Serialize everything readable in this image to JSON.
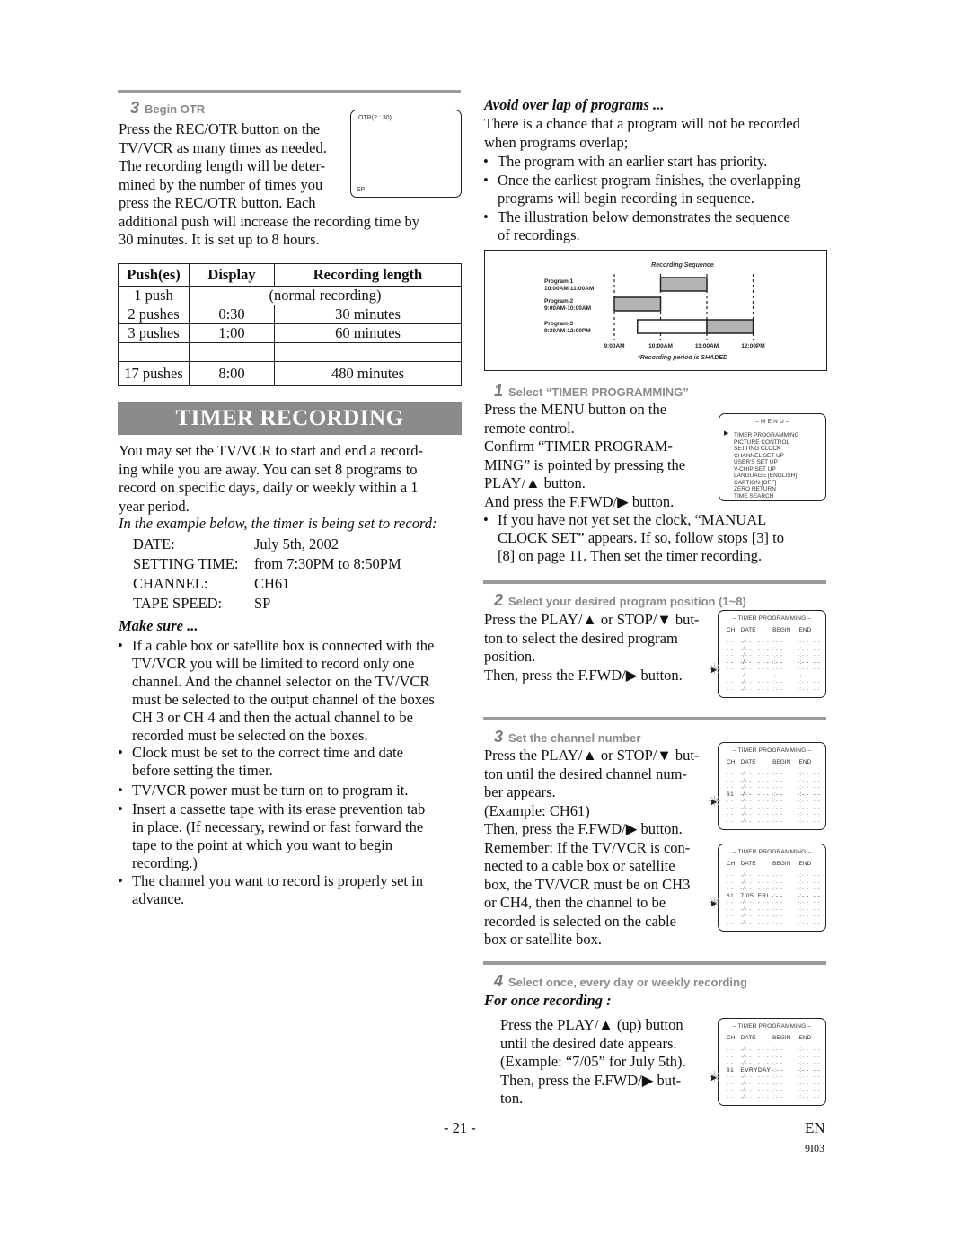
{
  "left": {
    "otr": {
      "step_num": "3",
      "step_title": "Begin OTR",
      "paragraph_lines": [
        "Press the REC/OTR button on the",
        "TV/VCR as many times as needed.",
        "The recording length will be deter-",
        "mined by the number of times you",
        "press the REC/OTR button. Each",
        "additional push will increase the recording time by",
        "30 minutes. It is set up to 8 hours."
      ],
      "screen": {
        "top_text": "OTR(2 : 30)",
        "bottom_text": "SP"
      }
    },
    "otr_table": {
      "headers": [
        "Push(es)",
        "Display",
        "Recording length"
      ],
      "rows": [
        {
          "pushes": "1 push",
          "merged": "(normal recording)"
        },
        {
          "pushes": "2 pushes",
          "display": "0:30",
          "length": "30 minutes"
        },
        {
          "pushes": "3 pushes",
          "display": "1:00",
          "length": "60 minutes"
        },
        {
          "pushes": "",
          "display": "",
          "length": ""
        },
        {
          "pushes": "17 pushes",
          "display": "8:00",
          "length": "480 minutes"
        }
      ]
    },
    "banner_title": "TIMER RECORDING",
    "intro_lines": [
      "You may set the TV/VCR to start and end a record-",
      "ing while you are away. You can set 8 programs to",
      "record on specific days, daily or weekly within a 1",
      "year period."
    ],
    "example_heading": "In the example below, the timer is being set to record:",
    "example": [
      {
        "label": "DATE:",
        "value": "July 5th, 2002"
      },
      {
        "label": "SETTING TIME:",
        "value": "from 7:30PM to 8:50PM"
      },
      {
        "label": "CHANNEL:",
        "value": "CH61"
      },
      {
        "label": "TAPE SPEED:",
        "value": "SP"
      }
    ],
    "make_sure_heading": "Make sure ...",
    "make_sure_bullets": [
      [
        "If a cable box or satellite box is connected with the",
        "TV/VCR you will be limited to record only one",
        "channel. And the channel selector on the TV/VCR",
        "must be selected to the output channel of the boxes",
        "CH 3 or CH 4 and then the actual channel to be",
        "recorded must be selected on the boxes."
      ],
      [
        "Clock must be set to the correct time and date",
        "before setting the timer."
      ],
      [
        "TV/VCR power must be turn on to program it."
      ],
      [
        "Insert a cassette tape with its erase prevention tab",
        "in place. (If necessary, rewind or fast forward the",
        "tape to the point at which you want to begin",
        "recording.)"
      ],
      [
        "The channel you want to record is properly set in",
        "advance."
      ]
    ]
  },
  "right": {
    "avoid_heading": "Avoid over lap of programs ...",
    "avoid_lines": [
      "There is a chance that a program will not be recorded",
      "when programs overlap;"
    ],
    "avoid_bullets": [
      [
        "The program with an earlier start has priority."
      ],
      [
        "Once the earliest program finishes, the overlapping",
        "programs will begin recording in sequence."
      ],
      [
        "The illustration below demonstrates the sequence",
        "of recordings."
      ]
    ],
    "sequence_diagram": {
      "title": "Recording Sequence",
      "footnote": "*Recording period is SHADED",
      "time_ticks": [
        "9:00AM",
        "10:00AM",
        "11:00AM",
        "12:00PM"
      ],
      "programs": [
        {
          "name": "Program 1",
          "time": "10:00AM-11:00AM",
          "start": 10,
          "end": 11,
          "recorded_start": 10,
          "recorded_end": 11
        },
        {
          "name": "Program 2",
          "time": "9:00AM-10:00AM",
          "start": 9,
          "end": 10,
          "recorded_start": 9,
          "recorded_end": 10
        },
        {
          "name": "Program 3",
          "time": "9:30AM-12:00PM",
          "start": 9.5,
          "end": 12,
          "recorded_start": 11,
          "recorded_end": 12
        }
      ],
      "colors": {
        "shaded": "#b4b4b4",
        "unshaded": "#ffffff"
      }
    },
    "step1": {
      "num": "1",
      "title": "Select “TIMER PROGRAMMING”",
      "lines": [
        "Press the MENU button on the",
        "remote control.",
        "Confirm “TIMER PROGRAM-",
        "MING” is pointed by pressing the",
        "PLAY/▲ button.",
        "And press the F.FWD/▶ button."
      ],
      "bullet": [
        "If you have not yet set the clock, “MANUAL",
        "CLOCK SET” appears. If so, follow stops [3] to",
        "[8] on page 11. Then set the timer recording."
      ],
      "menu": {
        "title": "– M E N U –",
        "items": [
          "TIMER PROGRAMMING",
          "PICTURE CONTROL",
          "SETTING CLOCK",
          "CHANNEL SET UP",
          "USER'S SET UP",
          "V-CHIP SET UP",
          "LANGUAGE  [ENGLISH]",
          "CAPTION  [OFF]",
          "ZERO RETURN",
          "TIME SEARCH"
        ],
        "selected_index": 0
      }
    },
    "step2": {
      "num": "2",
      "title": "Select your desired program position (1~8)",
      "lines": [
        "Press the PLAY/▲ or STOP/▼ but-",
        "ton to select the desired program",
        "position.",
        "Then, press the F.FWD/▶ button."
      ]
    },
    "step3": {
      "num": "3",
      "title": "Set the channel number",
      "lines": [
        "Press the PLAY/▲ or STOP/▼ but-",
        "ton until the desired channel num-",
        "ber appears.",
        "(Example: CH61)",
        "Then, press the F.FWD/▶ button.",
        "Remember: If the TV/VCR is con-",
        "nected to a cable box or satellite",
        "box, the TV/VCR must be on CH3",
        "or CH4, then the channel to be",
        "recorded is selected on the cable",
        "box or satellite box."
      ]
    },
    "step4": {
      "num": "4",
      "title": "Select once, every day or weekly recording",
      "subheading": "For once recording :",
      "lines": [
        "Press the PLAY/▲ (up) button",
        "until the desired date appears.",
        "(Example: “7/05” for July 5th).",
        "Then, press the F.FWD/▶ but-",
        "ton."
      ]
    },
    "timer_screen": {
      "title": "– TIMER PROGRAMMING –",
      "headers": [
        "CH",
        "DATE",
        "BEGIN",
        "END"
      ],
      "empty_cells": [
        "- -",
        "-/- -",
        "- - -",
        "-:- -",
        "-:- -",
        "- -"
      ]
    },
    "timer_screens": [
      {
        "sel_row": 3,
        "sel_values": [
          "- -",
          "-/- -",
          "- - -",
          "-:- -",
          "-:- -",
          "- -"
        ]
      },
      {
        "sel_row": 3,
        "sel_values": [
          "61",
          "-/- -",
          "- - -",
          "-:- -",
          "-:- -",
          "- -"
        ]
      },
      {
        "sel_row": 3,
        "sel_values": [
          "61",
          "7/05",
          "FRI",
          "-:- -",
          "-:- -",
          "- -"
        ]
      },
      {
        "sel_row": 3,
        "sel_values": [
          "61",
          "EVRY",
          "DAY",
          "-:- -",
          "-:- -",
          "- -"
        ]
      }
    ]
  },
  "footer": {
    "page_number": "- 21 -",
    "lang": "EN",
    "code": "9I03"
  }
}
